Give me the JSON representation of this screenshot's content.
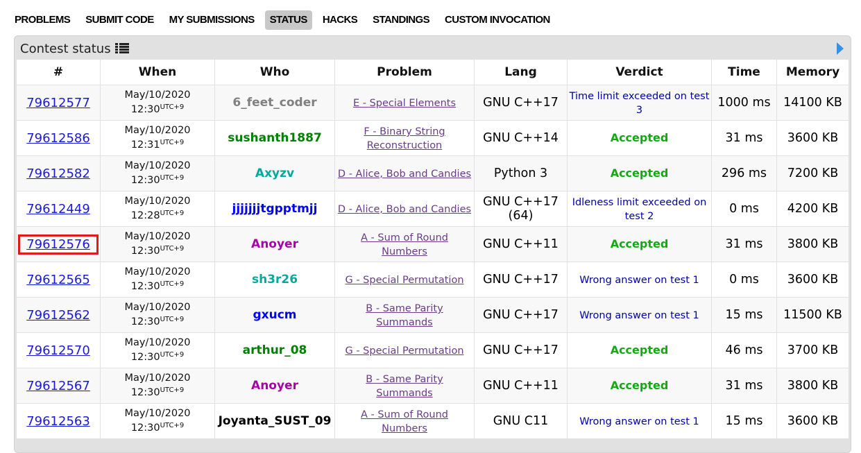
{
  "menu": {
    "items": [
      "PROBLEMS",
      "SUBMIT CODE",
      "MY SUBMISSIONS",
      "STATUS",
      "HACKS",
      "STANDINGS",
      "CUSTOM INVOCATION"
    ],
    "active": "STATUS"
  },
  "box": {
    "title": "Contest status"
  },
  "table": {
    "headers": [
      "#",
      "When",
      "Who",
      "Problem",
      "Lang",
      "Verdict",
      "Time",
      "Memory"
    ],
    "rows": [
      {
        "id": "79612577",
        "date": "May/10/2020",
        "time": "12:30",
        "tz": "UTC+9",
        "who": "6_feet_coder",
        "who_color": "#808080",
        "problem": "E - Special Elements",
        "lang": "GNU C++17",
        "verdict": "Time limit exceeded on test 3",
        "ok": false,
        "time_ms": "1000 ms",
        "memory": "14100 KB"
      },
      {
        "id": "79612586",
        "date": "May/10/2020",
        "time": "12:31",
        "tz": "UTC+9",
        "who": "sushanth1887",
        "who_color": "#008000",
        "problem": "F - Binary String Reconstruction",
        "lang": "GNU C++14",
        "verdict": "Accepted",
        "ok": true,
        "time_ms": "31 ms",
        "memory": "3600 KB"
      },
      {
        "id": "79612582",
        "date": "May/10/2020",
        "time": "12:30",
        "tz": "UTC+9",
        "who": "Axyzv",
        "who_color": "#03a89e",
        "problem": "D - Alice, Bob and Candies",
        "lang": "Python 3",
        "verdict": "Accepted",
        "ok": true,
        "time_ms": "296 ms",
        "memory": "7200 KB"
      },
      {
        "id": "79612449",
        "date": "May/10/2020",
        "time": "12:28",
        "tz": "UTC+9",
        "who": "jjjjjjjtgpptmjj",
        "who_color": "#0000ff",
        "problem": "D - Alice, Bob and Candies",
        "lang": "GNU C++17 (64)",
        "verdict": "Idleness limit exceeded on test 2",
        "ok": false,
        "time_ms": "0 ms",
        "memory": "4200 KB"
      },
      {
        "id": "79612576",
        "date": "May/10/2020",
        "time": "12:30",
        "tz": "UTC+9",
        "who": "Anoyer",
        "who_color": "#aa00aa",
        "problem": "A - Sum of Round Numbers",
        "lang": "GNU C++11",
        "verdict": "Accepted",
        "ok": true,
        "time_ms": "31 ms",
        "memory": "3800 KB",
        "highlight": true
      },
      {
        "id": "79612565",
        "date": "May/10/2020",
        "time": "12:30",
        "tz": "UTC+9",
        "who": "sh3r26",
        "who_color": "#03a89e",
        "problem": "G - Special Permutation",
        "lang": "GNU C++17",
        "verdict": "Wrong answer on test 1",
        "ok": false,
        "time_ms": "0 ms",
        "memory": "3600 KB"
      },
      {
        "id": "79612562",
        "date": "May/10/2020",
        "time": "12:30",
        "tz": "UTC+9",
        "who": "gxucm",
        "who_color": "#0000ff",
        "problem": "B - Same Parity Summands",
        "lang": "GNU C++17",
        "verdict": "Wrong answer on test 1",
        "ok": false,
        "time_ms": "15 ms",
        "memory": "11500 KB"
      },
      {
        "id": "79612570",
        "date": "May/10/2020",
        "time": "12:30",
        "tz": "UTC+9",
        "who": "arthur_08",
        "who_color": "#008000",
        "problem": "G - Special Permutation",
        "lang": "GNU C++17",
        "verdict": "Accepted",
        "ok": true,
        "time_ms": "46 ms",
        "memory": "3700 KB"
      },
      {
        "id": "79612567",
        "date": "May/10/2020",
        "time": "12:30",
        "tz": "UTC+9",
        "who": "Anoyer",
        "who_color": "#aa00aa",
        "problem": "B - Same Parity Summands",
        "lang": "GNU C++11",
        "verdict": "Accepted",
        "ok": true,
        "time_ms": "31 ms",
        "memory": "3800 KB"
      },
      {
        "id": "79612563",
        "date": "May/10/2020",
        "time": "12:30",
        "tz": "UTC+9",
        "who": "Joyanta_SUST_09",
        "who_color": "#000000",
        "problem": "A - Sum of Round Numbers",
        "lang": "GNU C11",
        "verdict": "Wrong answer on test 1",
        "ok": false,
        "time_ms": "15 ms",
        "memory": "3600 KB"
      }
    ]
  }
}
